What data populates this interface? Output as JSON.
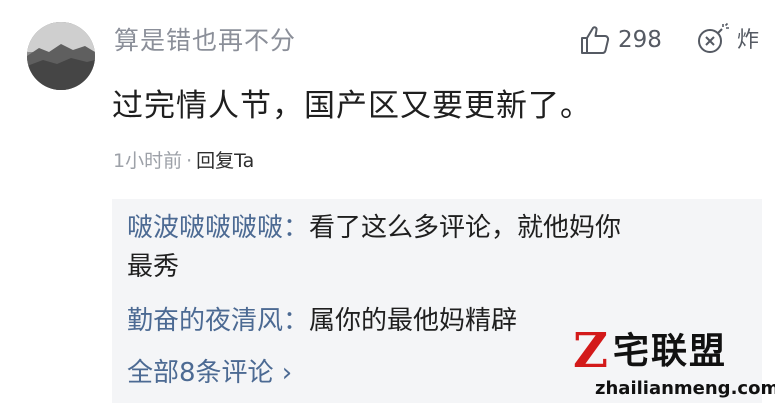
{
  "comment": {
    "username": "算是错也再不分",
    "like_count": "298",
    "bomb_label": "炸",
    "text": "过完情人节，国产区又要更新了。",
    "time": "1小时前",
    "separator": "·",
    "reply_label": "回复Ta"
  },
  "replies": {
    "items": [
      {
        "name": "啵波啵啵啵啵",
        "colon": "：",
        "text_line1": "看了这么多评论，就他妈你",
        "text_line2": "最秀"
      },
      {
        "name": "勤奋的夜清风",
        "colon": "：",
        "text_line1": "属你的最他妈精辟"
      }
    ],
    "all_label": "全部8条评论 ›"
  },
  "watermark": {
    "z": "Z",
    "title": "宅联盟",
    "url": "zhailianmeng.com"
  },
  "colors": {
    "username": "#8b8f99",
    "reply_name": "#4c6a93",
    "reply_bg": "#f4f5f7",
    "watermark_z": "#d31a1a"
  },
  "icons": [
    "avatar",
    "thumbs-up-icon",
    "bomb-icon"
  ]
}
